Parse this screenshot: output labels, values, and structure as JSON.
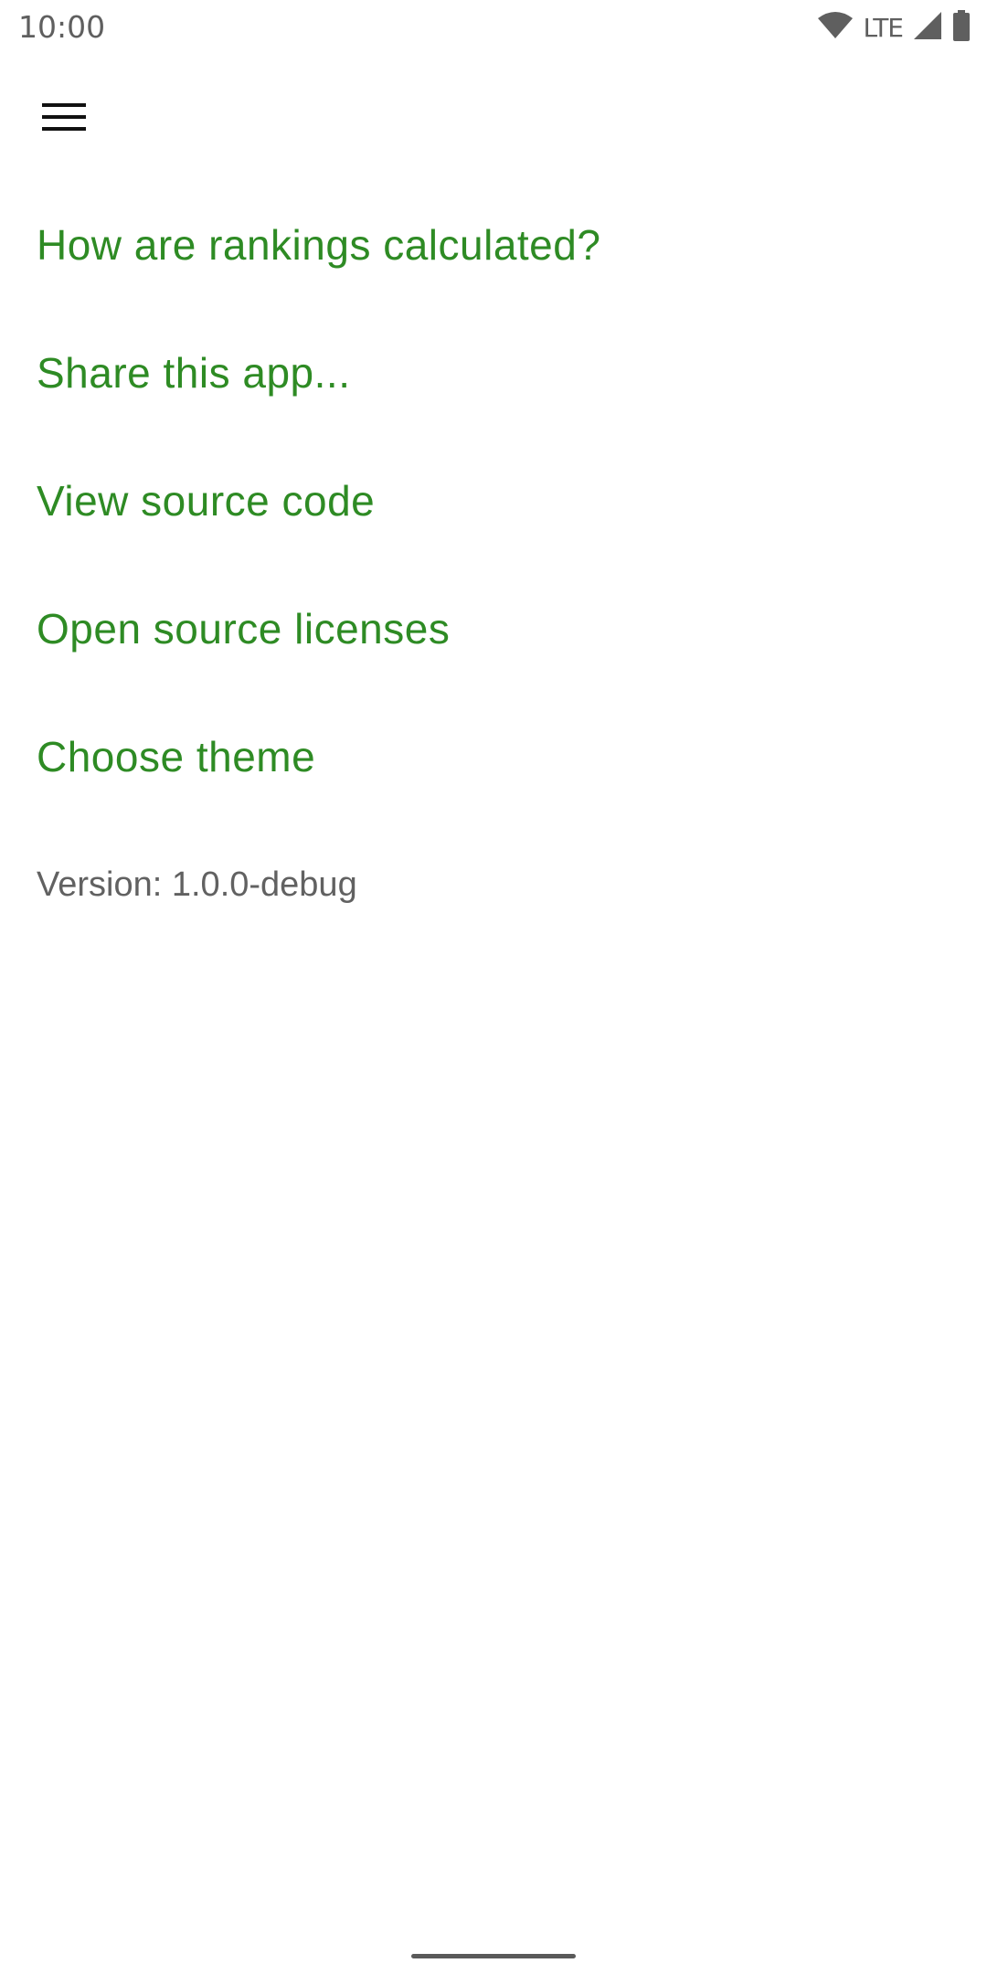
{
  "status_bar": {
    "time": "10:00",
    "network_label": "LTE",
    "icons": [
      "wifi-icon",
      "cell-signal-icon",
      "battery-icon"
    ]
  },
  "app_bar": {
    "menu_icon": "hamburger-menu-icon"
  },
  "menu": {
    "items": [
      {
        "label": "How are rankings calculated?"
      },
      {
        "label": "Share this app..."
      },
      {
        "label": "View source code"
      },
      {
        "label": "Open source licenses"
      },
      {
        "label": "Choose theme"
      }
    ],
    "version": "Version: 1.0.0-debug"
  },
  "colors": {
    "accent": "#2e8b24",
    "secondary_text": "#616161",
    "status": "#5f5f5f"
  }
}
